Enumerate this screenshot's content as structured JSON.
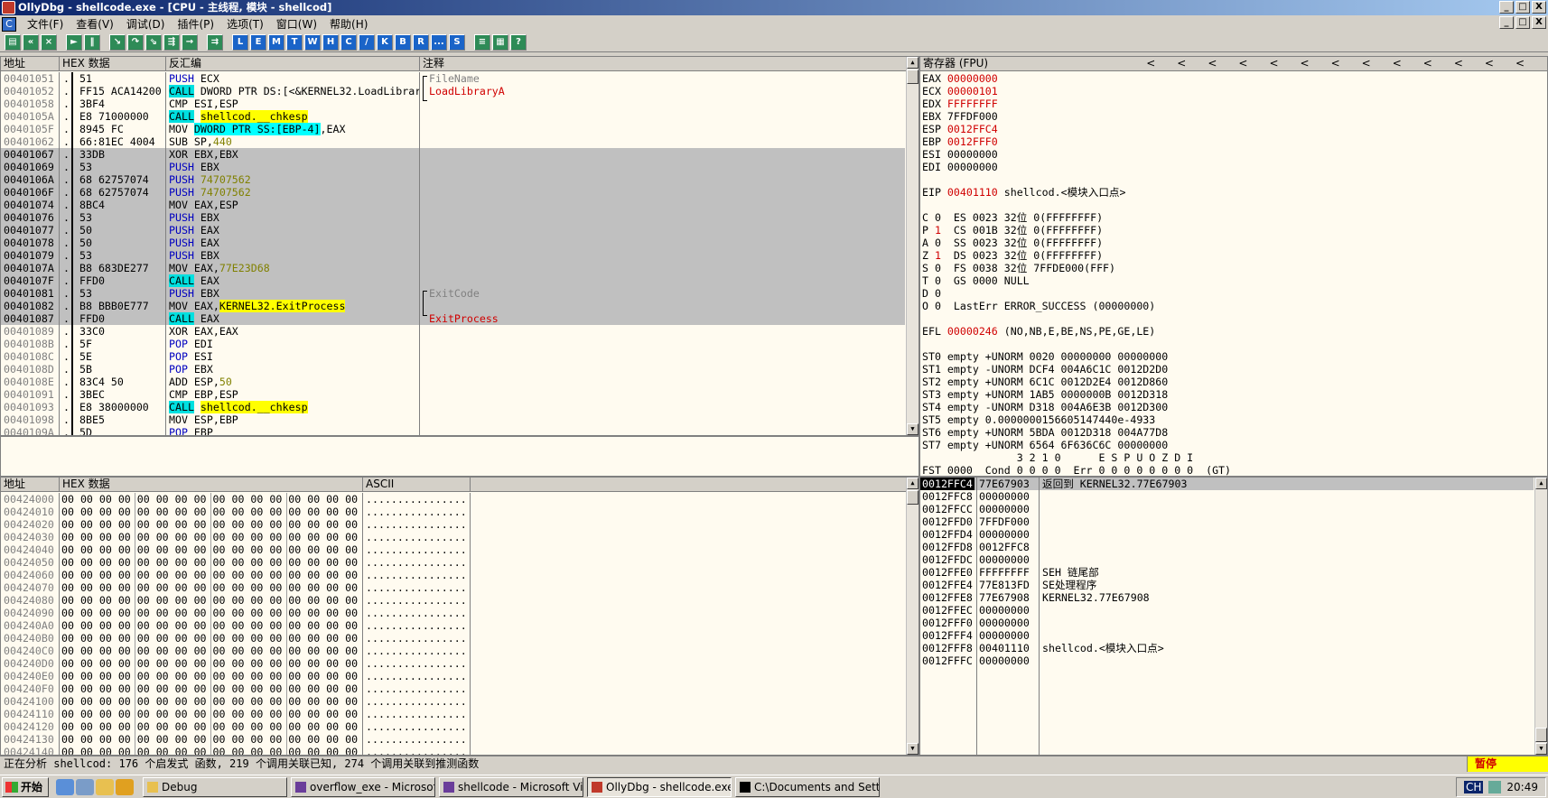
{
  "window": {
    "title": "OllyDbg - shellcode.exe - [CPU - 主线程, 模块 - shellcod]",
    "min": "_",
    "max": "□",
    "close": "X"
  },
  "menu": [
    "文件(F)",
    "查看(V)",
    "调试(D)",
    "插件(P)",
    "选项(T)",
    "窗口(W)",
    "帮助(H)"
  ],
  "toolbar": {
    "letters": [
      "L",
      "E",
      "M",
      "T",
      "W",
      "H",
      "C",
      "/",
      "K",
      "B",
      "R",
      "...",
      "S"
    ]
  },
  "disasm": {
    "headers": {
      "addr": "地址",
      "hex": "HEX 数据",
      "asm": "反汇编",
      "comment": "注释"
    },
    "rows": [
      {
        "addr": "00401051",
        "m": ".",
        "hex": "51",
        "asm": [
          [
            "PUSH ",
            "b"
          ],
          [
            "ECX",
            ""
          ]
        ],
        "cmt": "FileName",
        "cc": "g",
        "s": 0
      },
      {
        "addr": "00401052",
        "m": ".",
        "hex": "FF15 ACA14200",
        "asm": [
          [
            "CALL",
            "c"
          ],
          [
            " DWORD PTR DS:[<&KERNEL32.LoadLibrar",
            ""
          ]
        ],
        "cmt": "LoadLibraryA",
        "cc": "r",
        "s": 0
      },
      {
        "addr": "00401058",
        "m": ".",
        "hex": "3BF4",
        "asm": [
          [
            "CMP ESI,ESP",
            ""
          ]
        ],
        "cmt": "",
        "cc": "",
        "s": 0
      },
      {
        "addr": "0040105A",
        "m": ".",
        "hex": "E8 71000000",
        "asm": [
          [
            "CALL",
            "c"
          ],
          [
            " ",
            ""
          ],
          [
            "shellcod.__chkesp",
            "y"
          ]
        ],
        "cmt": "",
        "cc": "",
        "s": 0
      },
      {
        "addr": "0040105F",
        "m": ".",
        "hex": "8945 FC",
        "asm": [
          [
            "MOV ",
            ""
          ],
          [
            "DWORD PTR SS:[EBP-4]",
            "p"
          ],
          [
            ",EAX",
            ""
          ]
        ],
        "cmt": "",
        "cc": "",
        "s": 0
      },
      {
        "addr": "00401062",
        "m": ".",
        "hex": "66:81EC 4004",
        "asm": [
          [
            "SUB SP,",
            ""
          ],
          [
            "440",
            "o"
          ]
        ],
        "cmt": "",
        "cc": "",
        "s": 0
      },
      {
        "addr": "00401067",
        "m": ".",
        "hex": "33DB",
        "asm": [
          [
            "XOR EBX,EBX",
            ""
          ]
        ],
        "cmt": "",
        "cc": "",
        "s": 1
      },
      {
        "addr": "00401069",
        "m": ".",
        "hex": "53",
        "asm": [
          [
            "PUSH ",
            "b"
          ],
          [
            "EBX",
            ""
          ]
        ],
        "cmt": "",
        "cc": "",
        "s": 1
      },
      {
        "addr": "0040106A",
        "m": ".",
        "hex": "68 62757074",
        "asm": [
          [
            "PUSH ",
            "b"
          ],
          [
            "74707562",
            "o"
          ]
        ],
        "cmt": "",
        "cc": "",
        "s": 1
      },
      {
        "addr": "0040106F",
        "m": ".",
        "hex": "68 62757074",
        "asm": [
          [
            "PUSH ",
            "b"
          ],
          [
            "74707562",
            "o"
          ]
        ],
        "cmt": "",
        "cc": "",
        "s": 1
      },
      {
        "addr": "00401074",
        "m": ".",
        "hex": "8BC4",
        "asm": [
          [
            "MOV EAX,ESP",
            ""
          ]
        ],
        "cmt": "",
        "cc": "",
        "s": 1
      },
      {
        "addr": "00401076",
        "m": ".",
        "hex": "53",
        "asm": [
          [
            "PUSH ",
            "b"
          ],
          [
            "EBX",
            ""
          ]
        ],
        "cmt": "",
        "cc": "",
        "s": 1
      },
      {
        "addr": "00401077",
        "m": ".",
        "hex": "50",
        "asm": [
          [
            "PUSH ",
            "b"
          ],
          [
            "EAX",
            ""
          ]
        ],
        "cmt": "",
        "cc": "",
        "s": 1
      },
      {
        "addr": "00401078",
        "m": ".",
        "hex": "50",
        "asm": [
          [
            "PUSH ",
            "b"
          ],
          [
            "EAX",
            ""
          ]
        ],
        "cmt": "",
        "cc": "",
        "s": 1
      },
      {
        "addr": "00401079",
        "m": ".",
        "hex": "53",
        "asm": [
          [
            "PUSH ",
            "b"
          ],
          [
            "EBX",
            ""
          ]
        ],
        "cmt": "",
        "cc": "",
        "s": 1
      },
      {
        "addr": "0040107A",
        "m": ".",
        "hex": "B8 683DE277",
        "asm": [
          [
            "MOV EAX,",
            ""
          ],
          [
            "77E23D68",
            "o"
          ]
        ],
        "cmt": "",
        "cc": "",
        "s": 1
      },
      {
        "addr": "0040107F",
        "m": ".",
        "hex": "FFD0",
        "asm": [
          [
            "CALL",
            "c"
          ],
          [
            " EAX",
            ""
          ]
        ],
        "cmt": "",
        "cc": "",
        "s": 1
      },
      {
        "addr": "00401081",
        "m": ".",
        "hex": "53",
        "asm": [
          [
            "PUSH ",
            "b"
          ],
          [
            "EBX",
            ""
          ]
        ],
        "cmt": "ExitCode",
        "cc": "g",
        "s": 1
      },
      {
        "addr": "00401082",
        "m": ".",
        "hex": "B8 BBB0E777",
        "asm": [
          [
            "MOV EAX,",
            ""
          ],
          [
            "KERNEL32.ExitProcess",
            "y"
          ]
        ],
        "cmt": "",
        "cc": "",
        "s": 1
      },
      {
        "addr": "00401087",
        "m": ".",
        "hex": "FFD0",
        "asm": [
          [
            "CALL",
            "c"
          ],
          [
            " EAX",
            ""
          ]
        ],
        "cmt": "ExitProcess",
        "cc": "r",
        "s": 1
      },
      {
        "addr": "00401089",
        "m": ".",
        "hex": "33C0",
        "asm": [
          [
            "XOR EAX,EAX",
            ""
          ]
        ],
        "cmt": "",
        "cc": "",
        "s": 0
      },
      {
        "addr": "0040108B",
        "m": ".",
        "hex": "5F",
        "asm": [
          [
            "POP ",
            "b"
          ],
          [
            "EDI",
            ""
          ]
        ],
        "cmt": "",
        "cc": "",
        "s": 0
      },
      {
        "addr": "0040108C",
        "m": ".",
        "hex": "5E",
        "asm": [
          [
            "POP ",
            "b"
          ],
          [
            "ESI",
            ""
          ]
        ],
        "cmt": "",
        "cc": "",
        "s": 0
      },
      {
        "addr": "0040108D",
        "m": ".",
        "hex": "5B",
        "asm": [
          [
            "POP ",
            "b"
          ],
          [
            "EBX",
            ""
          ]
        ],
        "cmt": "",
        "cc": "",
        "s": 0
      },
      {
        "addr": "0040108E",
        "m": ".",
        "hex": "83C4 50",
        "asm": [
          [
            "ADD ESP,",
            ""
          ],
          [
            "50",
            "o"
          ]
        ],
        "cmt": "",
        "cc": "",
        "s": 0
      },
      {
        "addr": "00401091",
        "m": ".",
        "hex": "3BEC",
        "asm": [
          [
            "CMP EBP,ESP",
            ""
          ]
        ],
        "cmt": "",
        "cc": "",
        "s": 0
      },
      {
        "addr": "00401093",
        "m": ".",
        "hex": "E8 38000000",
        "asm": [
          [
            "CALL",
            "c"
          ],
          [
            " ",
            ""
          ],
          [
            "shellcod.__chkesp",
            "y"
          ]
        ],
        "cmt": "",
        "cc": "",
        "s": 0
      },
      {
        "addr": "00401098",
        "m": ".",
        "hex": "8BE5",
        "asm": [
          [
            "MOV ESP,EBP",
            ""
          ]
        ],
        "cmt": "",
        "cc": "",
        "s": 0
      },
      {
        "addr": "0040109A",
        "m": ".",
        "hex": "5D",
        "asm": [
          [
            "POP ",
            "b"
          ],
          [
            "EBP",
            ""
          ]
        ],
        "cmt": "",
        "cc": "",
        "s": 0
      }
    ]
  },
  "registers": {
    "header": "寄存器 (FPU)",
    "arrows": "<",
    "lines": [
      [
        [
          "EAX ",
          ""
        ],
        [
          "00000000",
          "r"
        ]
      ],
      [
        [
          "ECX ",
          ""
        ],
        [
          "00000101",
          "r"
        ]
      ],
      [
        [
          "EDX ",
          ""
        ],
        [
          "FFFFFFFF",
          "r"
        ]
      ],
      [
        [
          "EBX 7FFDF000",
          ""
        ]
      ],
      [
        [
          "ESP ",
          ""
        ],
        [
          "0012FFC4",
          "r"
        ]
      ],
      [
        [
          "EBP ",
          ""
        ],
        [
          "0012FFF0",
          "r"
        ]
      ],
      [
        [
          "ESI 00000000",
          ""
        ]
      ],
      [
        [
          "EDI 00000000",
          ""
        ]
      ],
      [
        [
          "",
          ""
        ]
      ],
      [
        [
          "EIP ",
          ""
        ],
        [
          "00401110",
          "r"
        ],
        [
          " shellcod.<模块入口点>",
          ""
        ]
      ],
      [
        [
          "",
          ""
        ]
      ],
      [
        [
          "C 0  ES 0023 32位 0(FFFFFFFF)",
          ""
        ]
      ],
      [
        [
          "P ",
          ""
        ],
        [
          "1",
          "r"
        ],
        [
          "  CS 001B 32位 0(FFFFFFFF)",
          ""
        ]
      ],
      [
        [
          "A 0  SS 0023 32位 0(FFFFFFFF)",
          ""
        ]
      ],
      [
        [
          "Z ",
          ""
        ],
        [
          "1",
          "r"
        ],
        [
          "  DS 0023 32位 0(FFFFFFFF)",
          ""
        ]
      ],
      [
        [
          "S 0  FS 0038 32位 7FFDE000(FFF)",
          ""
        ]
      ],
      [
        [
          "T 0  GS 0000 NULL",
          ""
        ]
      ],
      [
        [
          "D 0",
          ""
        ]
      ],
      [
        [
          "O 0  LastErr ERROR_SUCCESS (00000000)",
          ""
        ]
      ],
      [
        [
          "",
          ""
        ]
      ],
      [
        [
          "EFL ",
          ""
        ],
        [
          "00000246",
          "r"
        ],
        [
          " (NO,NB,E,BE,NS,PE,GE,LE)",
          ""
        ]
      ],
      [
        [
          "",
          ""
        ]
      ],
      [
        [
          "ST0 empty +UNORM 0020 00000000 00000000",
          ""
        ]
      ],
      [
        [
          "ST1 empty -UNORM DCF4 004A6C1C 0012D2D0",
          ""
        ]
      ],
      [
        [
          "ST2 empty +UNORM 6C1C 0012D2E4 0012D860",
          ""
        ]
      ],
      [
        [
          "ST3 empty +UNORM 1AB5 0000000B 0012D318",
          ""
        ]
      ],
      [
        [
          "ST4 empty -UNORM D318 004A6E3B 0012D300",
          ""
        ]
      ],
      [
        [
          "ST5 empty 0.0000000156605147440e-4933",
          ""
        ]
      ],
      [
        [
          "ST6 empty +UNORM 5BDA 0012D318 004A77D8",
          ""
        ]
      ],
      [
        [
          "ST7 empty +UNORM 6564 6F636C6C 00000000",
          ""
        ]
      ],
      [
        [
          "               3 2 1 0      E S P U O Z D I",
          ""
        ]
      ],
      [
        [
          "FST 0000  Cond 0 0 0 0  Err 0 0 0 0 0 0 0 0  (GT)",
          ""
        ]
      ],
      [
        [
          "FCW 027F  Prec NEAR,53  掩码    1 1 1 1 1 1",
          ""
        ]
      ]
    ]
  },
  "dump": {
    "headers": {
      "addr": "地址",
      "hex": "HEX 数据",
      "ascii": "ASCII"
    },
    "hexline": "00 00 00 00 00 00 00 00 00 00 00 00 00 00 00 00",
    "ascii": "................",
    "addrs": [
      "00424000",
      "00424010",
      "00424020",
      "00424030",
      "00424040",
      "00424050",
      "00424060",
      "00424070",
      "00424080",
      "00424090",
      "004240A0",
      "004240B0",
      "004240C0",
      "004240D0",
      "004240E0",
      "004240F0",
      "00424100",
      "00424110",
      "00424120",
      "00424130",
      "00424140"
    ]
  },
  "stack": {
    "rows": [
      {
        "a": "0012FFC4",
        "v": "77E67903",
        "c": "返回到 KERNEL32.77E67903",
        "s": 1
      },
      {
        "a": "0012FFC8",
        "v": "00000000",
        "c": "",
        "s": 0
      },
      {
        "a": "0012FFCC",
        "v": "00000000",
        "c": "",
        "s": 0
      },
      {
        "a": "0012FFD0",
        "v": "7FFDF000",
        "c": "",
        "s": 0
      },
      {
        "a": "0012FFD4",
        "v": "00000000",
        "c": "",
        "s": 0
      },
      {
        "a": "0012FFD8",
        "v": "0012FFC8",
        "c": "",
        "s": 0
      },
      {
        "a": "0012FFDC",
        "v": "00000000",
        "c": "",
        "s": 0
      },
      {
        "a": "0012FFE0",
        "v": "FFFFFFFF",
        "c": "SEH 链尾部",
        "s": 0
      },
      {
        "a": "0012FFE4",
        "v": "77E813FD",
        "c": "SE处理程序",
        "s": 0
      },
      {
        "a": "0012FFE8",
        "v": "77E67908",
        "c": "KERNEL32.77E67908",
        "s": 0
      },
      {
        "a": "0012FFEC",
        "v": "00000000",
        "c": "",
        "s": 0
      },
      {
        "a": "0012FFF0",
        "v": "00000000",
        "c": "",
        "s": 0
      },
      {
        "a": "0012FFF4",
        "v": "00000000",
        "c": "",
        "s": 0
      },
      {
        "a": "0012FFF8",
        "v": "00401110",
        "c": "shellcod.<模块入口点>",
        "s": 0
      },
      {
        "a": "0012FFFC",
        "v": "00000000",
        "c": "",
        "s": 0
      }
    ]
  },
  "status": {
    "text": "正在分析 shellcod: 176 个启发式 函数, 219 个调用关联已知, 274 个调用关联到推测函数",
    "state": "暂停"
  },
  "taskbar": {
    "start": "开始",
    "tasks": [
      "Debug",
      "overflow_exe - Microsoft ...",
      "shellcode - Microsoft Visu...",
      "OllyDbg - shellcode.exe - ...",
      "C:\\Documents and Settin..."
    ],
    "active": 3,
    "lang": "CH",
    "clock": "20:49"
  }
}
